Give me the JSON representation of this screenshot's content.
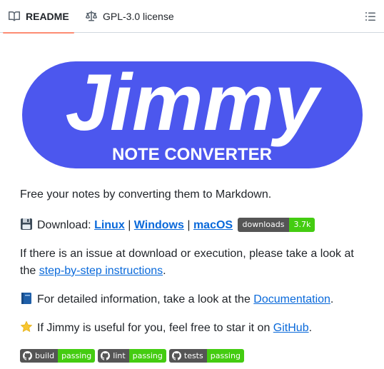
{
  "tabs": {
    "readme": {
      "label": "README",
      "icon": "book-icon"
    },
    "license": {
      "label": "GPL-3.0 license",
      "icon": "law-scale-icon"
    },
    "outline_icon": "list-outline-icon"
  },
  "logo": {
    "title": "Jimmy",
    "subtitle": "NOTE CONVERTER",
    "color": "#4c57ee"
  },
  "content": {
    "tagline": "Free your notes by converting them to Markdown.",
    "download": {
      "icon": "floppy-disk-emoji",
      "prefix": "Download:",
      "links": [
        "Linux",
        "Windows",
        "macOS"
      ],
      "separator": "|",
      "badge_label": "downloads",
      "badge_value": "3.7k"
    },
    "issue": {
      "text": "If there is an issue at download or execution, please take a look at the",
      "link": "step-by-step instructions",
      "end": "."
    },
    "docs": {
      "icon": "blue-book-emoji",
      "text": "For detailed information, take a look at the",
      "link": "Documentation",
      "end": "."
    },
    "star": {
      "icon": "star-emoji",
      "text": "If Jimmy is useful for you, feel free to star it on",
      "link": "GitHub",
      "end": "."
    }
  },
  "badges": [
    {
      "label": "build",
      "value": "passing"
    },
    {
      "label": "lint",
      "value": "passing"
    },
    {
      "label": "tests",
      "value": "passing"
    }
  ],
  "colors": {
    "link": "#0969da",
    "badge_green": "#44cc11",
    "badge_gray": "#555555",
    "tab_underline": "#fd8c73"
  }
}
